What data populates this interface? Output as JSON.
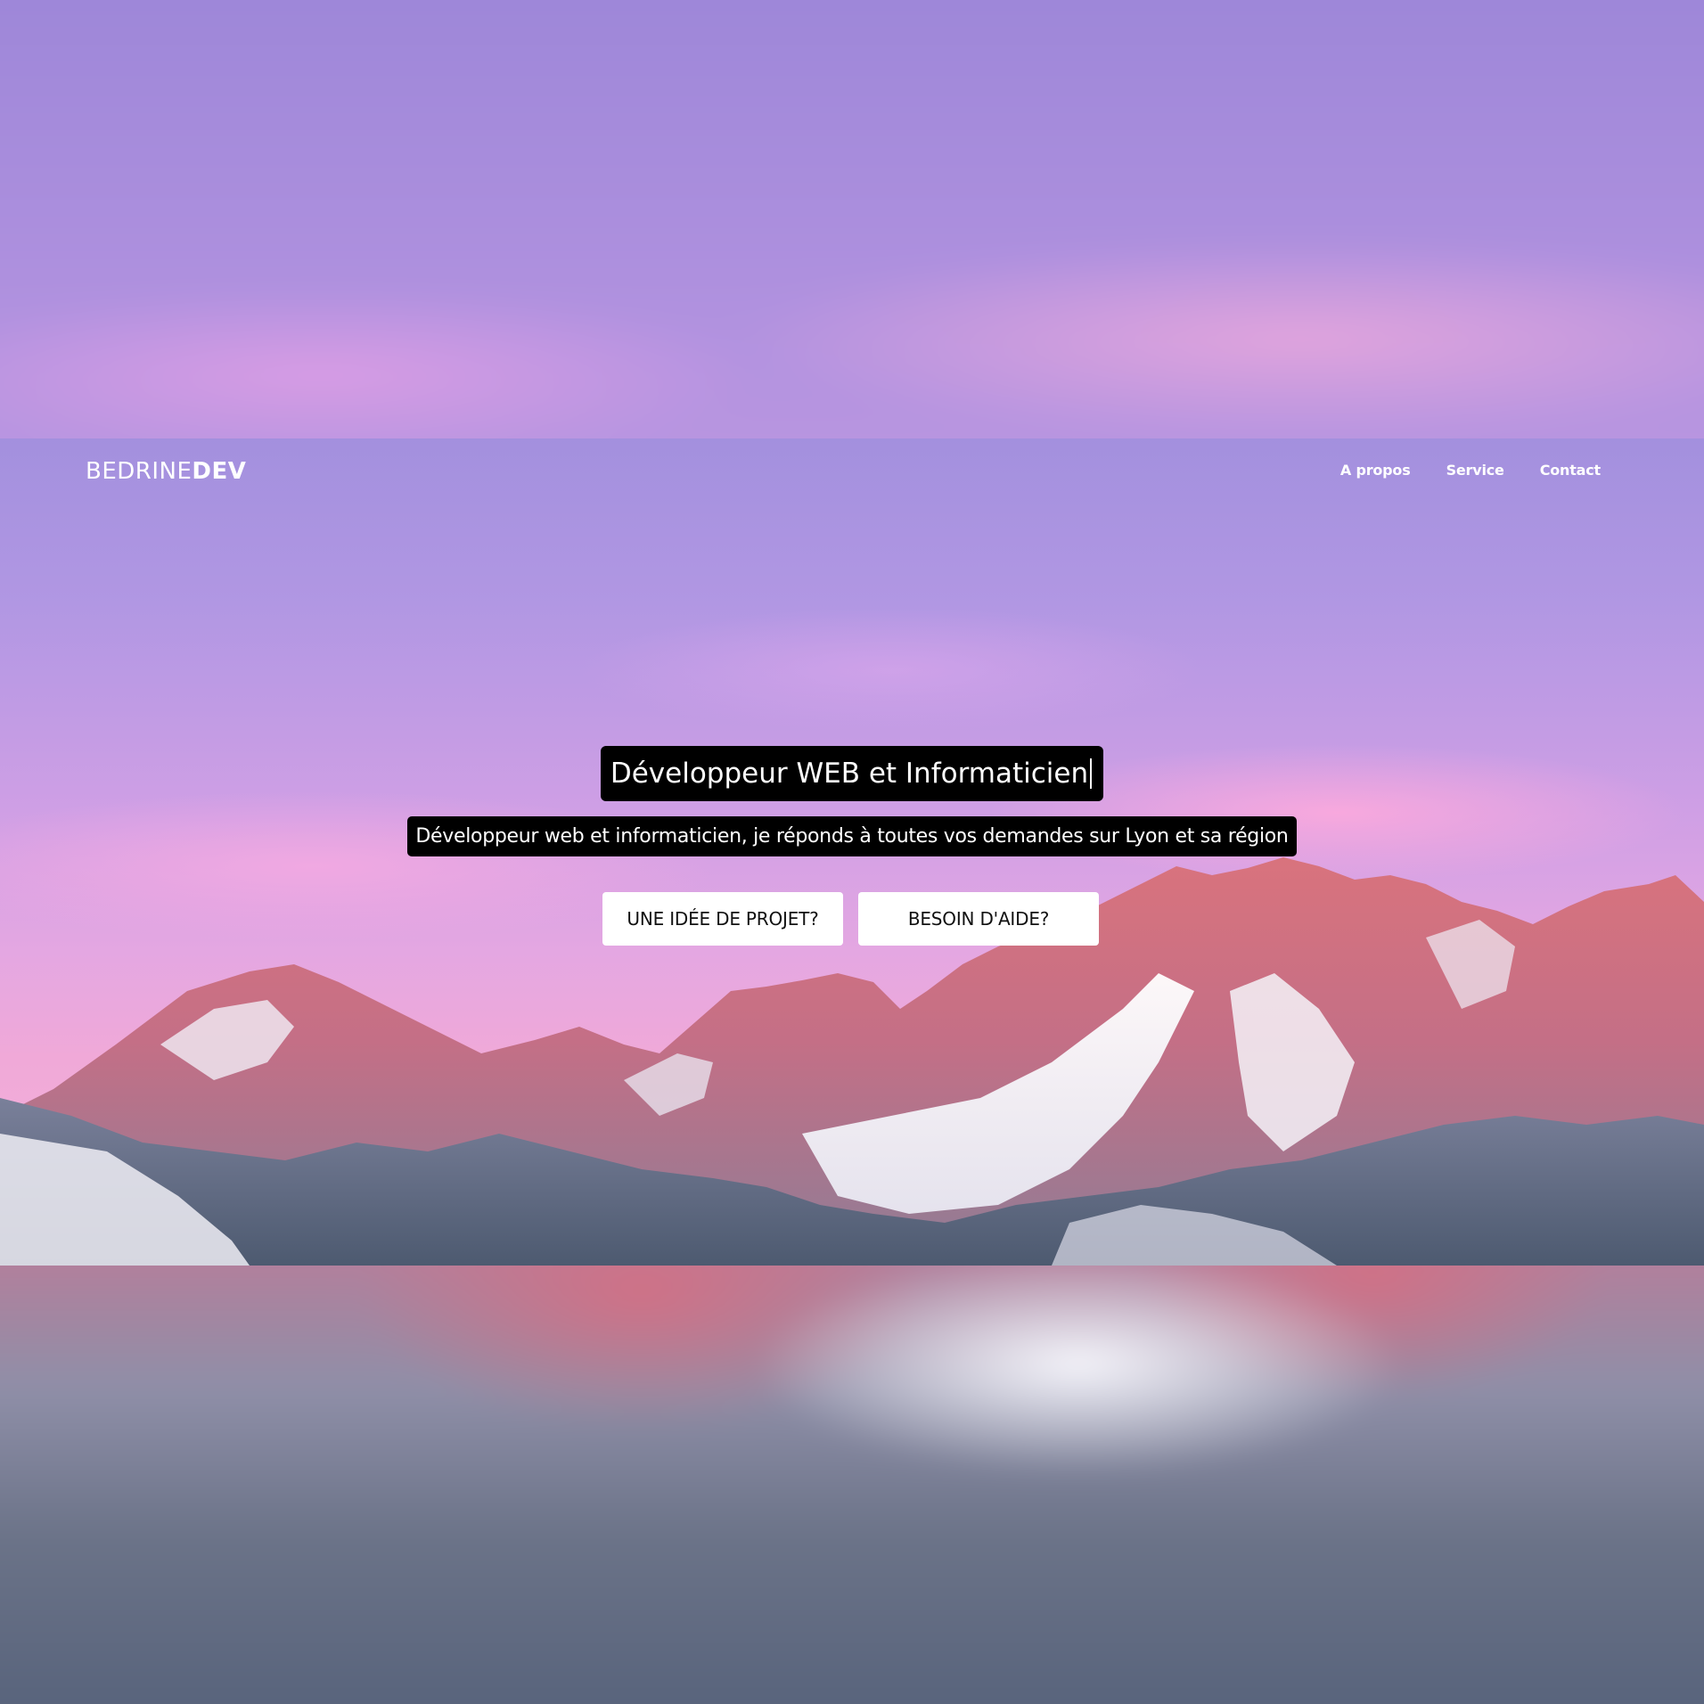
{
  "navbar": {
    "logo_light": "BEDRINE",
    "logo_bold": "DEV",
    "links": [
      "A propos",
      "Service",
      "Contact"
    ]
  },
  "hero": {
    "headline": "Développeur WEB et Informaticien",
    "subline": "Développeur web et informaticien, je réponds à toutes vos demandes sur Lyon et sa région",
    "buttons": [
      "UNE IDÉE DE PROJET?",
      "BESOIN D'AIDE?"
    ]
  },
  "colors": {
    "sky_top": "#a390de",
    "sky_pink": "#f0a9d8",
    "text_box": "#000000",
    "button_bg": "#ffffff"
  }
}
